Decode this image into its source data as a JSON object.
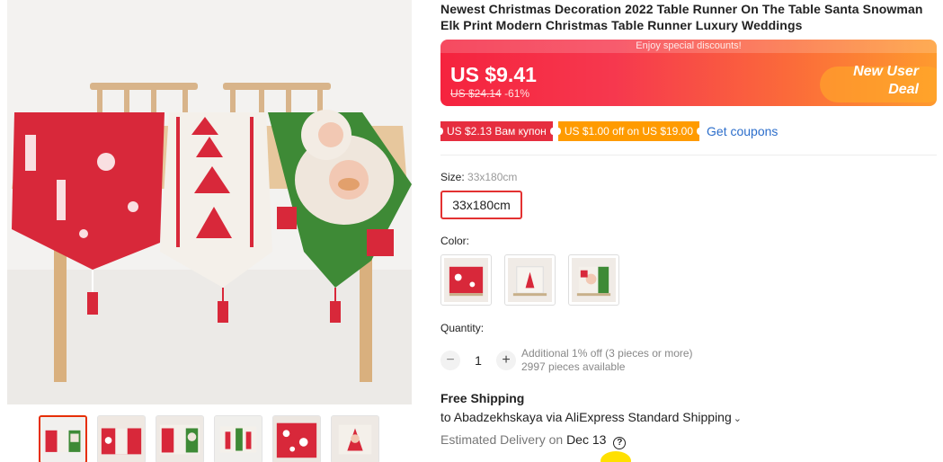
{
  "product": {
    "title": "Newest Christmas Decoration 2022 Table Runner On The Table Santa Snowman Elk Print Modern Christmas Table Runner Luxury Weddings",
    "main_image": "christmas-table-runner-photo",
    "thumbnails": [
      "thumb-1",
      "thumb-2",
      "thumb-3",
      "thumb-4",
      "thumb-5",
      "thumb-6"
    ]
  },
  "price": {
    "banner_text": "Enjoy special discounts!",
    "current": "US $9.41",
    "original": "US $24.14",
    "discount": "-61%",
    "deal_label": "New User Deal",
    "colors": {
      "start": "#f5233e",
      "end": "#fe9a2e"
    }
  },
  "coupons": {
    "items": [
      "US $2.13 Вам купон",
      "US $1.00 off on US $19.00"
    ],
    "link": "Get coupons"
  },
  "size": {
    "label": "Size:",
    "selected_value": "33x180cm",
    "options": [
      "33x180cm"
    ]
  },
  "color": {
    "label": "Color:",
    "options": [
      "red-elk-runner",
      "white-tree-runner",
      "santa-green-runner"
    ]
  },
  "quantity": {
    "label": "Quantity:",
    "minus": "−",
    "value": "1",
    "plus": "+",
    "note_discount": "Additional 1% off (3 pieces or more)",
    "note_available": "2997 pieces available"
  },
  "shipping": {
    "title": "Free Shipping",
    "line": "to Abadzekhskaya via AliExpress Standard Shipping",
    "chevron": "⌄",
    "delivery_label": "Estimated Delivery on",
    "delivery_date": "Dec 13",
    "help": "?"
  },
  "accent_color": "#e62e04"
}
